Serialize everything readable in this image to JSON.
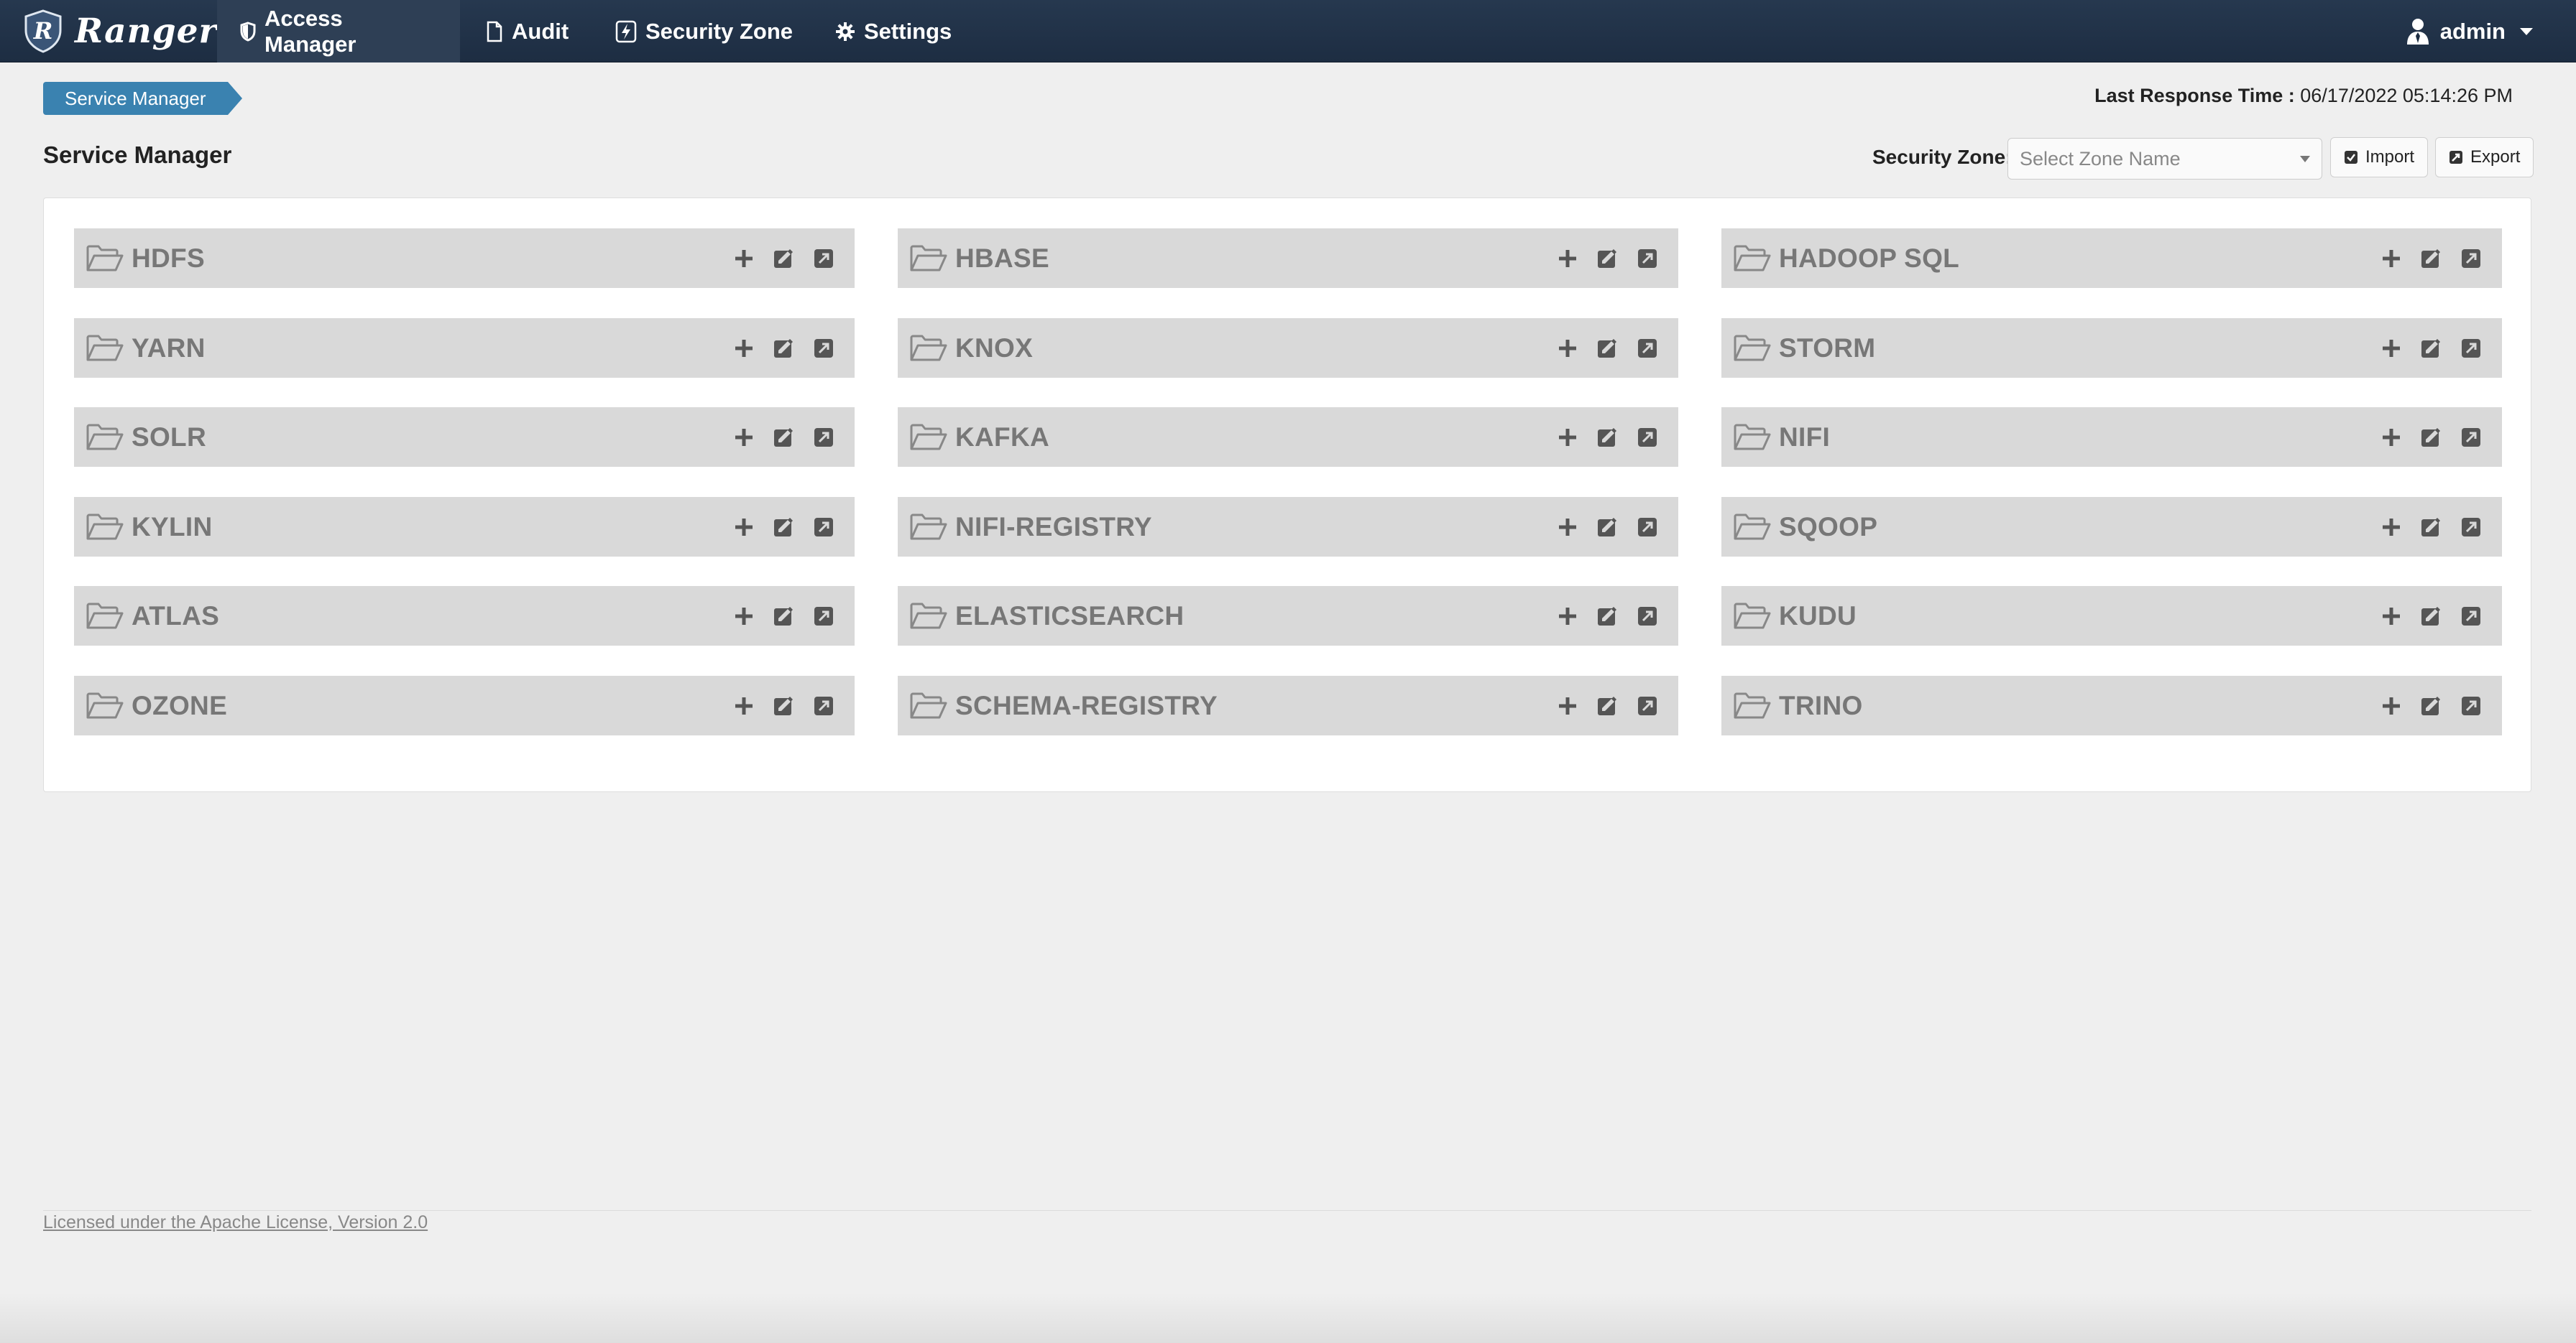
{
  "brand": {
    "name": "Ranger",
    "logo_letter": "R"
  },
  "nav": {
    "items": [
      {
        "label": "Access Manager",
        "icon": "shield-icon"
      },
      {
        "label": "Audit",
        "icon": "file-icon"
      },
      {
        "label": "Security Zone",
        "icon": "lightning-icon"
      },
      {
        "label": "Settings",
        "icon": "gear-icon"
      }
    ],
    "user": {
      "label": "admin",
      "icon": "user-icon"
    }
  },
  "breadcrumb": {
    "label": "Service Manager"
  },
  "last_response": {
    "label": "Last Response Time :",
    "value": "06/17/2022 05:14:26 PM"
  },
  "page": {
    "title": "Service Manager"
  },
  "zone": {
    "label": "Security Zone:",
    "placeholder": "Select Zone Name"
  },
  "buttons": {
    "import": "Import",
    "export": "Export"
  },
  "services": [
    {
      "name": "HDFS"
    },
    {
      "name": "HBASE"
    },
    {
      "name": "HADOOP SQL"
    },
    {
      "name": "YARN"
    },
    {
      "name": "KNOX"
    },
    {
      "name": "STORM"
    },
    {
      "name": "SOLR"
    },
    {
      "name": "KAFKA"
    },
    {
      "name": "NIFI"
    },
    {
      "name": "KYLIN"
    },
    {
      "name": "NIFI-REGISTRY"
    },
    {
      "name": "SQOOP"
    },
    {
      "name": "ATLAS"
    },
    {
      "name": "ELASTICSEARCH"
    },
    {
      "name": "KUDU"
    },
    {
      "name": "OZONE"
    },
    {
      "name": "SCHEMA-REGISTRY"
    },
    {
      "name": "TRINO"
    }
  ],
  "service_action_icons": [
    "plus-icon",
    "edit-icon",
    "external-link-icon"
  ],
  "footer": {
    "license": "Licensed under the Apache License, Version 2.0"
  },
  "colors": {
    "navbar": "#1d2d42",
    "breadcrumb": "#3a82b0",
    "service_bg": "#d9d9d9",
    "service_text": "#777777"
  }
}
